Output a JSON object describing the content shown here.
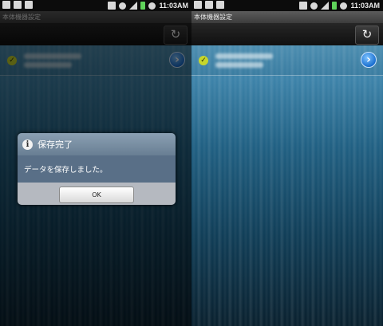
{
  "status": {
    "time": "11:03AM",
    "left_icons": [
      "photo-icon",
      "mail-icon",
      "android-icon"
    ],
    "right_icons": [
      "vibrate-icon",
      "wifi-icon",
      "signal-icon",
      "battery-icon",
      "alarm-icon"
    ]
  },
  "app": {
    "title": "本体機器設定",
    "refresh_icon": "↻"
  },
  "device_row": {
    "check_icon": "✓",
    "chevron_icon": "›",
    "colors": {
      "check": "#c7d62b",
      "chevron": "#1a6fd0"
    }
  },
  "dialog": {
    "title": "保存完了",
    "info_icon": "i",
    "message": "データを保存しました。",
    "ok_label": "OK"
  }
}
